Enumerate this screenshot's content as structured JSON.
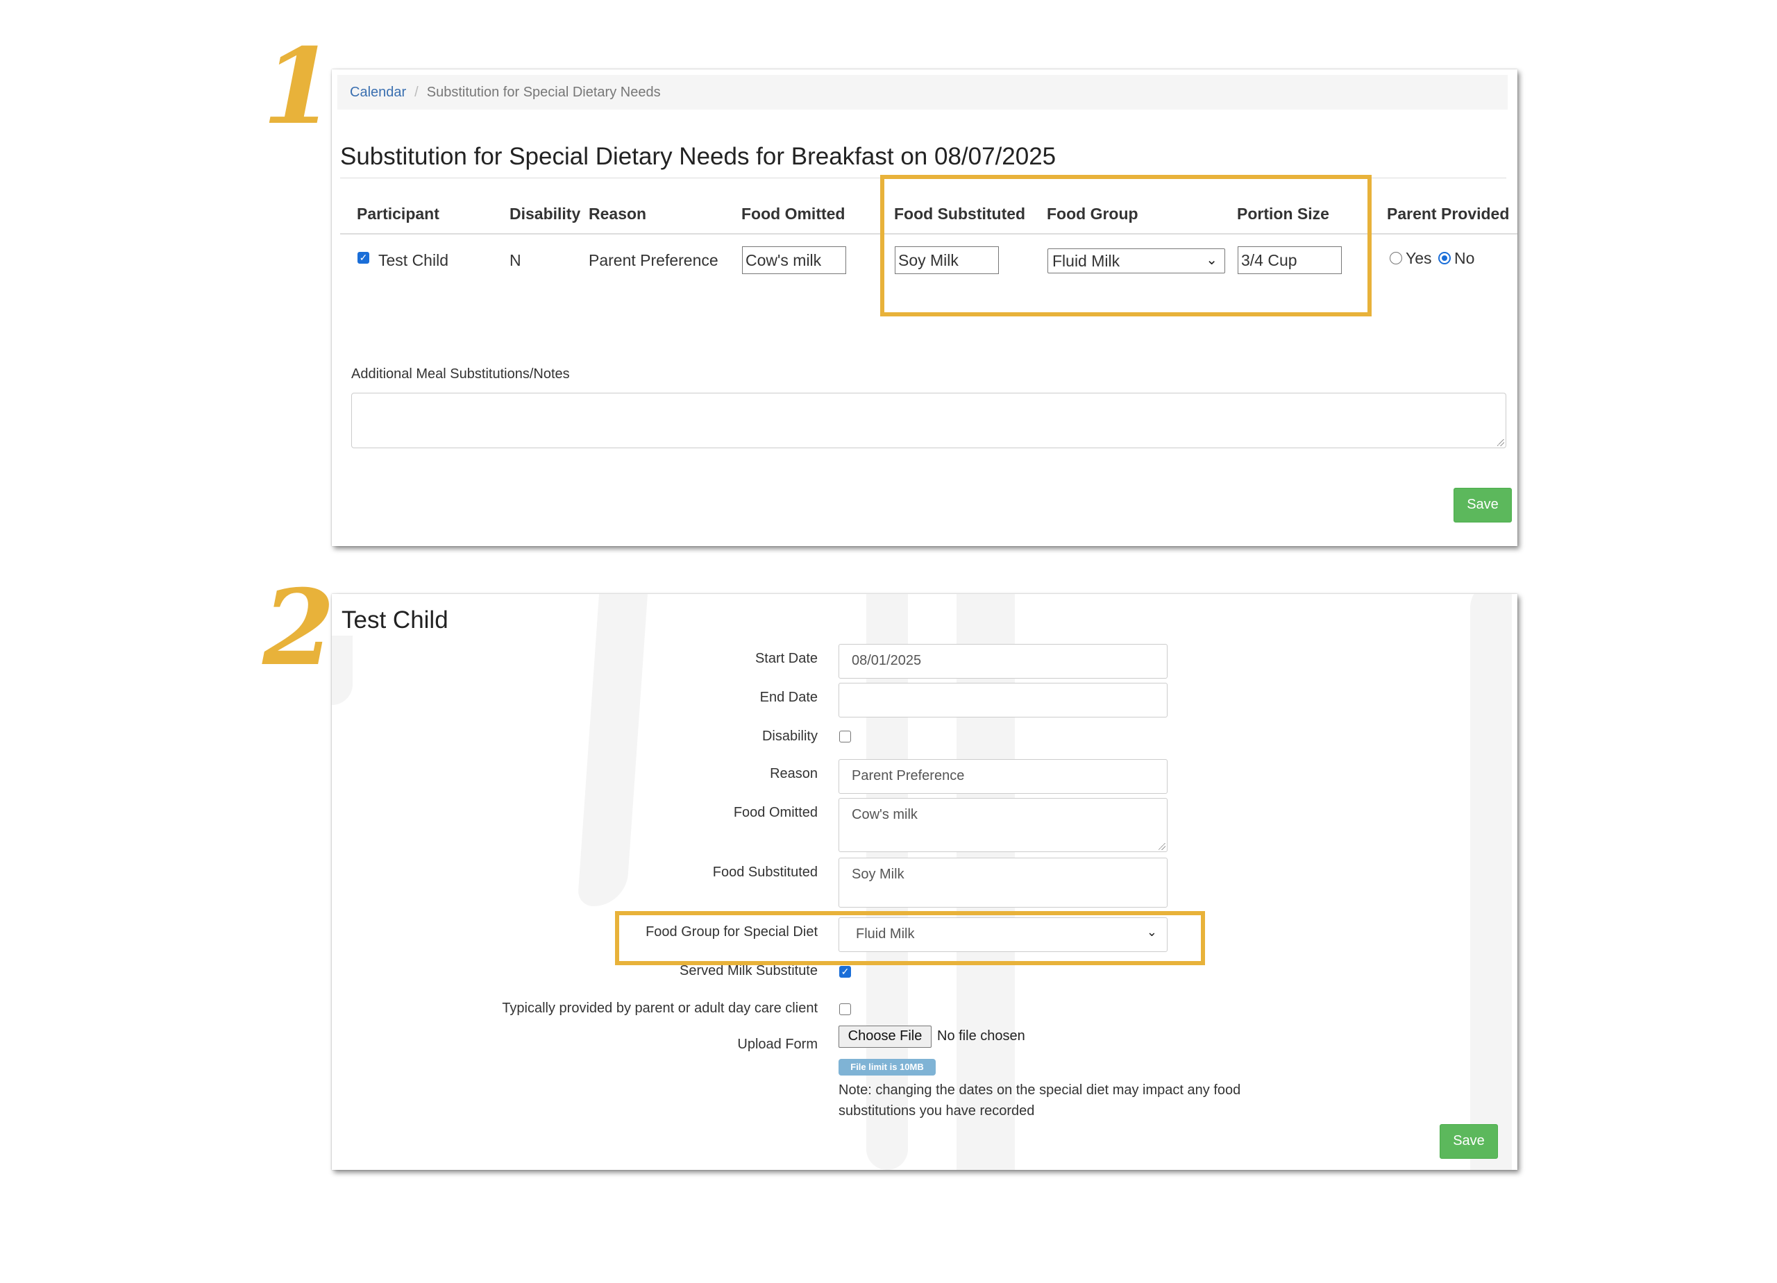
{
  "steps": [
    "1",
    "2"
  ],
  "panel1": {
    "breadcrumb": {
      "link": "Calendar",
      "separator": "/",
      "current": "Substitution for Special Dietary Needs"
    },
    "title": "Substitution for Special Dietary Needs for Breakfast on 08/07/2025",
    "columns": [
      "Participant",
      "Disability",
      "Reason",
      "Food Omitted",
      "Food Substituted",
      "Food Group",
      "Portion Size",
      "Parent Provided"
    ],
    "row": {
      "participant_checked": true,
      "participant": "Test Child",
      "disability": "N",
      "reason": "Parent Preference",
      "food_omitted": "Cow's milk",
      "food_substituted": "Soy Milk",
      "food_group": "Fluid Milk",
      "portion_size": "3/4 Cup",
      "parent_provided_yes": "Yes",
      "parent_provided_no": "No",
      "parent_provided_selected": "No"
    },
    "notes_label": "Additional Meal Substitutions/Notes",
    "notes_value": "",
    "save_label": "Save"
  },
  "panel2": {
    "title": "Test Child",
    "fields": {
      "start_date_label": "Start Date",
      "start_date_value": "08/01/2025",
      "end_date_label": "End Date",
      "end_date_value": "",
      "disability_label": "Disability",
      "disability_checked": false,
      "reason_label": "Reason",
      "reason_value": "Parent Preference",
      "food_omitted_label": "Food Omitted",
      "food_omitted_value": "Cow's milk",
      "food_substituted_label": "Food Substituted",
      "food_substituted_value": "Soy Milk",
      "food_group_label": "Food Group for Special Diet",
      "food_group_value": "Fluid Milk",
      "served_milk_label": "Served Milk Substitute",
      "served_milk_checked": true,
      "typically_provided_label": "Typically provided by parent or adult day care client",
      "typically_provided_checked": false,
      "upload_label": "Upload Form",
      "choose_file_label": "Choose File",
      "no_file_label": "No file chosen",
      "file_limit_badge": "File limit is 10MB",
      "note": "Note: changing the dates on the special diet may impact any food substitutions you have recorded"
    },
    "save_label": "Save"
  },
  "colors": {
    "highlight": "#e8b23a",
    "save_button": "#5cb85c",
    "checkbox": "#1a6ed8",
    "link": "#3a6fb0",
    "badge": "#7fb3d5"
  }
}
